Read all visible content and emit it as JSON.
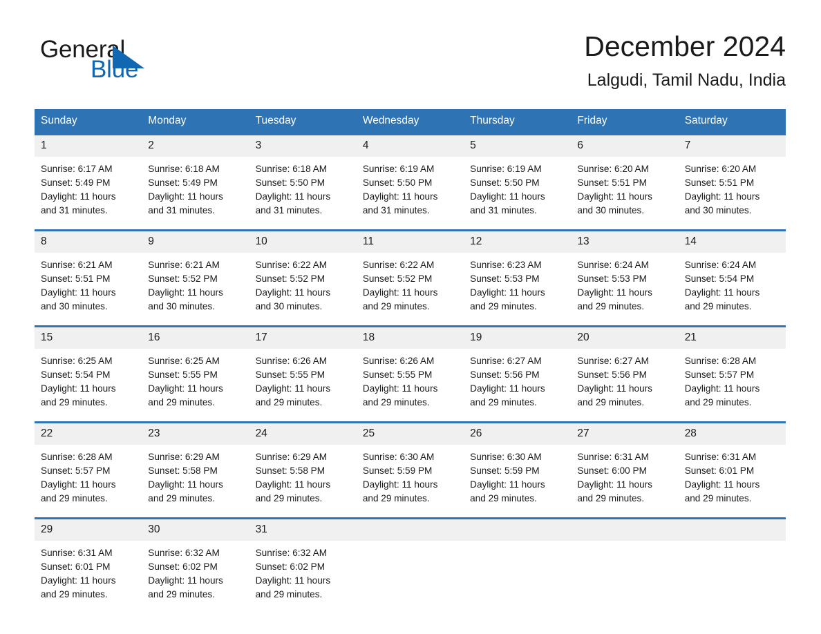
{
  "brand": {
    "name_part1": "General",
    "name_part2": "Blue",
    "triangle_color": "#1267b3",
    "accent_color": "#2e73b3"
  },
  "header": {
    "title": "December 2024",
    "location": "Lalgudi, Tamil Nadu, India"
  },
  "calendar": {
    "weekday_headers": [
      "Sunday",
      "Monday",
      "Tuesday",
      "Wednesday",
      "Thursday",
      "Friday",
      "Saturday"
    ],
    "weeks": [
      [
        {
          "day": "1",
          "sunrise": "Sunrise: 6:17 AM",
          "sunset": "Sunset: 5:49 PM",
          "daylight_line1": "Daylight: 11 hours",
          "daylight_line2": "and 31 minutes."
        },
        {
          "day": "2",
          "sunrise": "Sunrise: 6:18 AM",
          "sunset": "Sunset: 5:49 PM",
          "daylight_line1": "Daylight: 11 hours",
          "daylight_line2": "and 31 minutes."
        },
        {
          "day": "3",
          "sunrise": "Sunrise: 6:18 AM",
          "sunset": "Sunset: 5:50 PM",
          "daylight_line1": "Daylight: 11 hours",
          "daylight_line2": "and 31 minutes."
        },
        {
          "day": "4",
          "sunrise": "Sunrise: 6:19 AM",
          "sunset": "Sunset: 5:50 PM",
          "daylight_line1": "Daylight: 11 hours",
          "daylight_line2": "and 31 minutes."
        },
        {
          "day": "5",
          "sunrise": "Sunrise: 6:19 AM",
          "sunset": "Sunset: 5:50 PM",
          "daylight_line1": "Daylight: 11 hours",
          "daylight_line2": "and 31 minutes."
        },
        {
          "day": "6",
          "sunrise": "Sunrise: 6:20 AM",
          "sunset": "Sunset: 5:51 PM",
          "daylight_line1": "Daylight: 11 hours",
          "daylight_line2": "and 30 minutes."
        },
        {
          "day": "7",
          "sunrise": "Sunrise: 6:20 AM",
          "sunset": "Sunset: 5:51 PM",
          "daylight_line1": "Daylight: 11 hours",
          "daylight_line2": "and 30 minutes."
        }
      ],
      [
        {
          "day": "8",
          "sunrise": "Sunrise: 6:21 AM",
          "sunset": "Sunset: 5:51 PM",
          "daylight_line1": "Daylight: 11 hours",
          "daylight_line2": "and 30 minutes."
        },
        {
          "day": "9",
          "sunrise": "Sunrise: 6:21 AM",
          "sunset": "Sunset: 5:52 PM",
          "daylight_line1": "Daylight: 11 hours",
          "daylight_line2": "and 30 minutes."
        },
        {
          "day": "10",
          "sunrise": "Sunrise: 6:22 AM",
          "sunset": "Sunset: 5:52 PM",
          "daylight_line1": "Daylight: 11 hours",
          "daylight_line2": "and 30 minutes."
        },
        {
          "day": "11",
          "sunrise": "Sunrise: 6:22 AM",
          "sunset": "Sunset: 5:52 PM",
          "daylight_line1": "Daylight: 11 hours",
          "daylight_line2": "and 29 minutes."
        },
        {
          "day": "12",
          "sunrise": "Sunrise: 6:23 AM",
          "sunset": "Sunset: 5:53 PM",
          "daylight_line1": "Daylight: 11 hours",
          "daylight_line2": "and 29 minutes."
        },
        {
          "day": "13",
          "sunrise": "Sunrise: 6:24 AM",
          "sunset": "Sunset: 5:53 PM",
          "daylight_line1": "Daylight: 11 hours",
          "daylight_line2": "and 29 minutes."
        },
        {
          "day": "14",
          "sunrise": "Sunrise: 6:24 AM",
          "sunset": "Sunset: 5:54 PM",
          "daylight_line1": "Daylight: 11 hours",
          "daylight_line2": "and 29 minutes."
        }
      ],
      [
        {
          "day": "15",
          "sunrise": "Sunrise: 6:25 AM",
          "sunset": "Sunset: 5:54 PM",
          "daylight_line1": "Daylight: 11 hours",
          "daylight_line2": "and 29 minutes."
        },
        {
          "day": "16",
          "sunrise": "Sunrise: 6:25 AM",
          "sunset": "Sunset: 5:55 PM",
          "daylight_line1": "Daylight: 11 hours",
          "daylight_line2": "and 29 minutes."
        },
        {
          "day": "17",
          "sunrise": "Sunrise: 6:26 AM",
          "sunset": "Sunset: 5:55 PM",
          "daylight_line1": "Daylight: 11 hours",
          "daylight_line2": "and 29 minutes."
        },
        {
          "day": "18",
          "sunrise": "Sunrise: 6:26 AM",
          "sunset": "Sunset: 5:55 PM",
          "daylight_line1": "Daylight: 11 hours",
          "daylight_line2": "and 29 minutes."
        },
        {
          "day": "19",
          "sunrise": "Sunrise: 6:27 AM",
          "sunset": "Sunset: 5:56 PM",
          "daylight_line1": "Daylight: 11 hours",
          "daylight_line2": "and 29 minutes."
        },
        {
          "day": "20",
          "sunrise": "Sunrise: 6:27 AM",
          "sunset": "Sunset: 5:56 PM",
          "daylight_line1": "Daylight: 11 hours",
          "daylight_line2": "and 29 minutes."
        },
        {
          "day": "21",
          "sunrise": "Sunrise: 6:28 AM",
          "sunset": "Sunset: 5:57 PM",
          "daylight_line1": "Daylight: 11 hours",
          "daylight_line2": "and 29 minutes."
        }
      ],
      [
        {
          "day": "22",
          "sunrise": "Sunrise: 6:28 AM",
          "sunset": "Sunset: 5:57 PM",
          "daylight_line1": "Daylight: 11 hours",
          "daylight_line2": "and 29 minutes."
        },
        {
          "day": "23",
          "sunrise": "Sunrise: 6:29 AM",
          "sunset": "Sunset: 5:58 PM",
          "daylight_line1": "Daylight: 11 hours",
          "daylight_line2": "and 29 minutes."
        },
        {
          "day": "24",
          "sunrise": "Sunrise: 6:29 AM",
          "sunset": "Sunset: 5:58 PM",
          "daylight_line1": "Daylight: 11 hours",
          "daylight_line2": "and 29 minutes."
        },
        {
          "day": "25",
          "sunrise": "Sunrise: 6:30 AM",
          "sunset": "Sunset: 5:59 PM",
          "daylight_line1": "Daylight: 11 hours",
          "daylight_line2": "and 29 minutes."
        },
        {
          "day": "26",
          "sunrise": "Sunrise: 6:30 AM",
          "sunset": "Sunset: 5:59 PM",
          "daylight_line1": "Daylight: 11 hours",
          "daylight_line2": "and 29 minutes."
        },
        {
          "day": "27",
          "sunrise": "Sunrise: 6:31 AM",
          "sunset": "Sunset: 6:00 PM",
          "daylight_line1": "Daylight: 11 hours",
          "daylight_line2": "and 29 minutes."
        },
        {
          "day": "28",
          "sunrise": "Sunrise: 6:31 AM",
          "sunset": "Sunset: 6:01 PM",
          "daylight_line1": "Daylight: 11 hours",
          "daylight_line2": "and 29 minutes."
        }
      ],
      [
        {
          "day": "29",
          "sunrise": "Sunrise: 6:31 AM",
          "sunset": "Sunset: 6:01 PM",
          "daylight_line1": "Daylight: 11 hours",
          "daylight_line2": "and 29 minutes."
        },
        {
          "day": "30",
          "sunrise": "Sunrise: 6:32 AM",
          "sunset": "Sunset: 6:02 PM",
          "daylight_line1": "Daylight: 11 hours",
          "daylight_line2": "and 29 minutes."
        },
        {
          "day": "31",
          "sunrise": "Sunrise: 6:32 AM",
          "sunset": "Sunset: 6:02 PM",
          "daylight_line1": "Daylight: 11 hours",
          "daylight_line2": "and 29 minutes."
        },
        {
          "day": "",
          "sunrise": "",
          "sunset": "",
          "daylight_line1": "",
          "daylight_line2": ""
        },
        {
          "day": "",
          "sunrise": "",
          "sunset": "",
          "daylight_line1": "",
          "daylight_line2": ""
        },
        {
          "day": "",
          "sunrise": "",
          "sunset": "",
          "daylight_line1": "",
          "daylight_line2": ""
        },
        {
          "day": "",
          "sunrise": "",
          "sunset": "",
          "daylight_line1": "",
          "daylight_line2": ""
        }
      ]
    ]
  }
}
